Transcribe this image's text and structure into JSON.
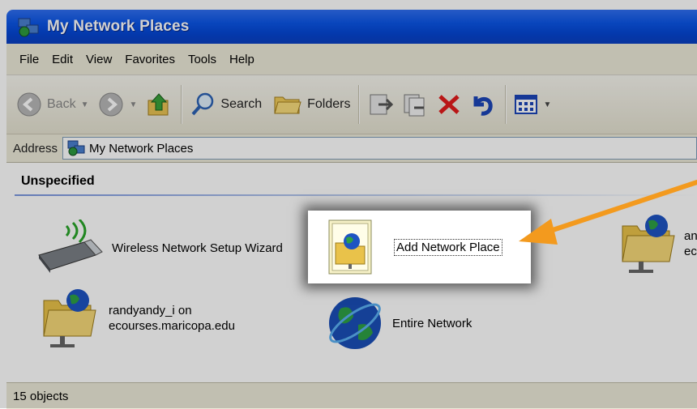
{
  "window": {
    "title": "My Network Places"
  },
  "menu": {
    "items": [
      {
        "label": "File"
      },
      {
        "label": "Edit"
      },
      {
        "label": "View"
      },
      {
        "label": "Favorites"
      },
      {
        "label": "Tools"
      },
      {
        "label": "Help"
      }
    ]
  },
  "toolbar": {
    "back_label": "Back",
    "search_label": "Search",
    "folders_label": "Folders"
  },
  "address": {
    "label": "Address",
    "value": "My Network Places"
  },
  "content": {
    "group_header": "Unspecified",
    "items": [
      {
        "label": "Wireless Network Setup Wizard",
        "icon": "wireless-usb-icon"
      },
      {
        "label": "Add Network Place",
        "icon": "add-network-place-icon"
      },
      {
        "label_line1": "an",
        "label_line2": "ec",
        "icon": "network-folder-icon"
      },
      {
        "label_line1": "randyandy_i on",
        "label_line2": "ecourses.maricopa.edu",
        "icon": "network-folder-icon"
      },
      {
        "label": "Entire Network",
        "icon": "globe-icon"
      }
    ]
  },
  "status": {
    "text": "15 objects"
  },
  "colors": {
    "title_bar": "#0b55e6",
    "chrome": "#ece9d8",
    "arrow": "#f39a1e"
  }
}
